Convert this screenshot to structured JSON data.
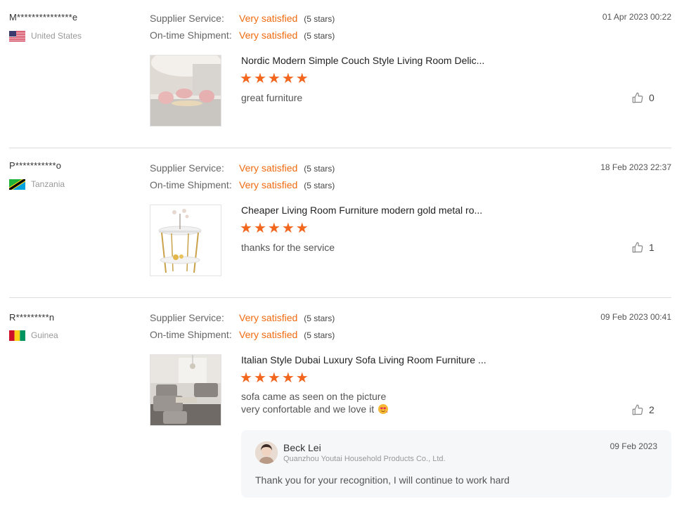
{
  "labels": {
    "supplier_service": "Supplier Service:",
    "ontime_shipment": "On-time Shipment:"
  },
  "reviews": [
    {
      "buyer": "M***************e",
      "country": "United States",
      "flag_icon": "us-flag-icon",
      "supplier_value": "Very satisfied",
      "supplier_stars": "(5 stars)",
      "shipment_value": "Very satisfied",
      "shipment_stars": "(5 stars)",
      "date": "01 Apr 2023 00:22",
      "product_title": "Nordic Modern Simple Couch Style Living Room Delic...",
      "rating": 5,
      "comment": "great furniture",
      "likes": "0"
    },
    {
      "buyer": "P***********o",
      "country": "Tanzania",
      "flag_icon": "tanzania-flag-icon",
      "supplier_value": "Very satisfied",
      "supplier_stars": "(5 stars)",
      "shipment_value": "Very satisfied",
      "shipment_stars": "(5 stars)",
      "date": "18 Feb 2023 22:37",
      "product_title": "Cheaper Living Room Furniture modern gold metal ro...",
      "rating": 5,
      "comment": "thanks for the service",
      "likes": "1"
    },
    {
      "buyer": "R*********n",
      "country": "Guinea",
      "flag_icon": "guinea-flag-icon",
      "supplier_value": "Very satisfied",
      "supplier_stars": "(5 stars)",
      "shipment_value": "Very satisfied",
      "shipment_stars": "(5 stars)",
      "date": "09 Feb 2023 00:41",
      "product_title": "Italian Style Dubai Luxury Sofa Living Room Furniture ...",
      "rating": 5,
      "comment_line1": "sofa came as seen on the picture",
      "comment_line2": "very confortable and we love it",
      "comment_emoji_icon": "heart-face-emoji-icon",
      "likes": "2",
      "reply": {
        "name": "Beck Lei",
        "company": "Quanzhou Youtai Household Products Co., Ltd.",
        "date": "09 Feb 2023",
        "text": "Thank you for your recognition, I will continue to work hard"
      }
    }
  ],
  "colors": {
    "accent": "#f06a0f",
    "star": "#f2661e",
    "divider": "#dddddd",
    "reply_bg": "#f6f7f9"
  }
}
